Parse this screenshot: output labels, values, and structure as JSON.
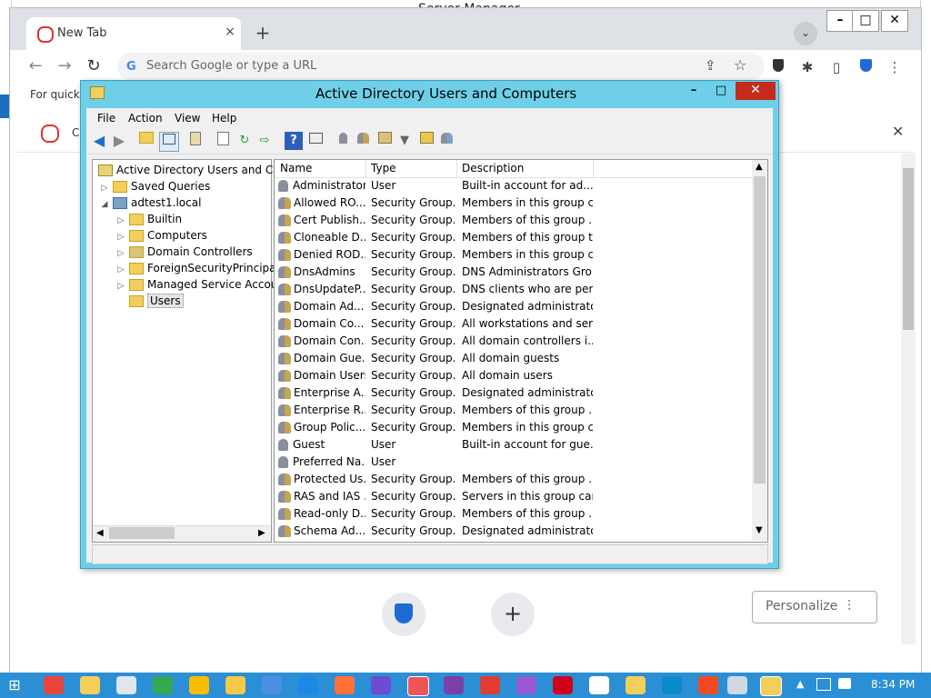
{
  "server_manager": {
    "title": "Server Manager"
  },
  "chrome": {
    "tab_title": "New Tab",
    "tab_close": "×",
    "new_tab": "+",
    "tab_menu": "⌄",
    "window_min": "–",
    "window_max": "□",
    "window_close": "✕",
    "back": "←",
    "forward": "→",
    "reload": "↻",
    "omnibox_placeholder": "Search Google or type a URL",
    "share": "⇪",
    "star": "☆",
    "extensions": "✱",
    "sidebar": "▯",
    "menu": "⋮",
    "bookmarks_hint": "For quick a",
    "banner_text": "CO",
    "banner_close": "✕",
    "plus_button": "+",
    "personalize_label": "Personalize",
    "personalize_icon": "⫶"
  },
  "aduc": {
    "title": "Active Directory Users and Computers",
    "min": "–",
    "max": "□",
    "close": "✕",
    "menu": {
      "file": "File",
      "action": "Action",
      "view": "View",
      "help": "Help"
    },
    "tree": {
      "root": "Active Directory Users and Com",
      "saved_queries": "Saved Queries",
      "domain": "adtest1.local",
      "builtin": "Builtin",
      "computers": "Computers",
      "domain_controllers": "Domain Controllers",
      "foreign": "ForeignSecurityPrincipals",
      "msa": "Managed Service Accoun",
      "users": "Users"
    },
    "columns": {
      "name": "Name",
      "type": "Type",
      "description": "Description"
    },
    "rows": [
      {
        "name": "Administrator",
        "type": "User",
        "description": "Built-in account for ad..."
      },
      {
        "name": "Allowed RO...",
        "type": "Security Group...",
        "description": "Members in this group c..."
      },
      {
        "name": "Cert Publish...",
        "type": "Security Group...",
        "description": "Members of this group ..."
      },
      {
        "name": "Cloneable D...",
        "type": "Security Group...",
        "description": "Members of this group t..."
      },
      {
        "name": "Denied ROD...",
        "type": "Security Group...",
        "description": "Members in this group c..."
      },
      {
        "name": "DnsAdmins",
        "type": "Security Group...",
        "description": "DNS Administrators Gro..."
      },
      {
        "name": "DnsUpdateP...",
        "type": "Security Group...",
        "description": "DNS clients who are per..."
      },
      {
        "name": "Domain Ad...",
        "type": "Security Group...",
        "description": "Designated administrato..."
      },
      {
        "name": "Domain Co...",
        "type": "Security Group...",
        "description": "All workstations and ser..."
      },
      {
        "name": "Domain Con...",
        "type": "Security Group...",
        "description": "All domain controllers i..."
      },
      {
        "name": "Domain Gue...",
        "type": "Security Group...",
        "description": "All domain guests"
      },
      {
        "name": "Domain Users",
        "type": "Security Group...",
        "description": "All domain users"
      },
      {
        "name": "Enterprise A...",
        "type": "Security Group...",
        "description": "Designated administrato..."
      },
      {
        "name": "Enterprise R...",
        "type": "Security Group...",
        "description": "Members of this group ..."
      },
      {
        "name": "Group Polic...",
        "type": "Security Group...",
        "description": "Members in this group c..."
      },
      {
        "name": "Guest",
        "type": "User",
        "description": "Built-in account for gue..."
      },
      {
        "name": "Preferred Na...",
        "type": "User",
        "description": ""
      },
      {
        "name": "Protected Us...",
        "type": "Security Group...",
        "description": "Members of this group ..."
      },
      {
        "name": "RAS and IAS ...",
        "type": "Security Group...",
        "description": "Servers in this group can..."
      },
      {
        "name": "Read-only D...",
        "type": "Security Group...",
        "description": "Members of this group ..."
      },
      {
        "name": "Schema Ad...",
        "type": "Security Group...",
        "description": "Designated administrato..."
      }
    ]
  },
  "taskbar": {
    "time": "8:34 PM",
    "start": "⊞",
    "tray_up": "▲"
  }
}
